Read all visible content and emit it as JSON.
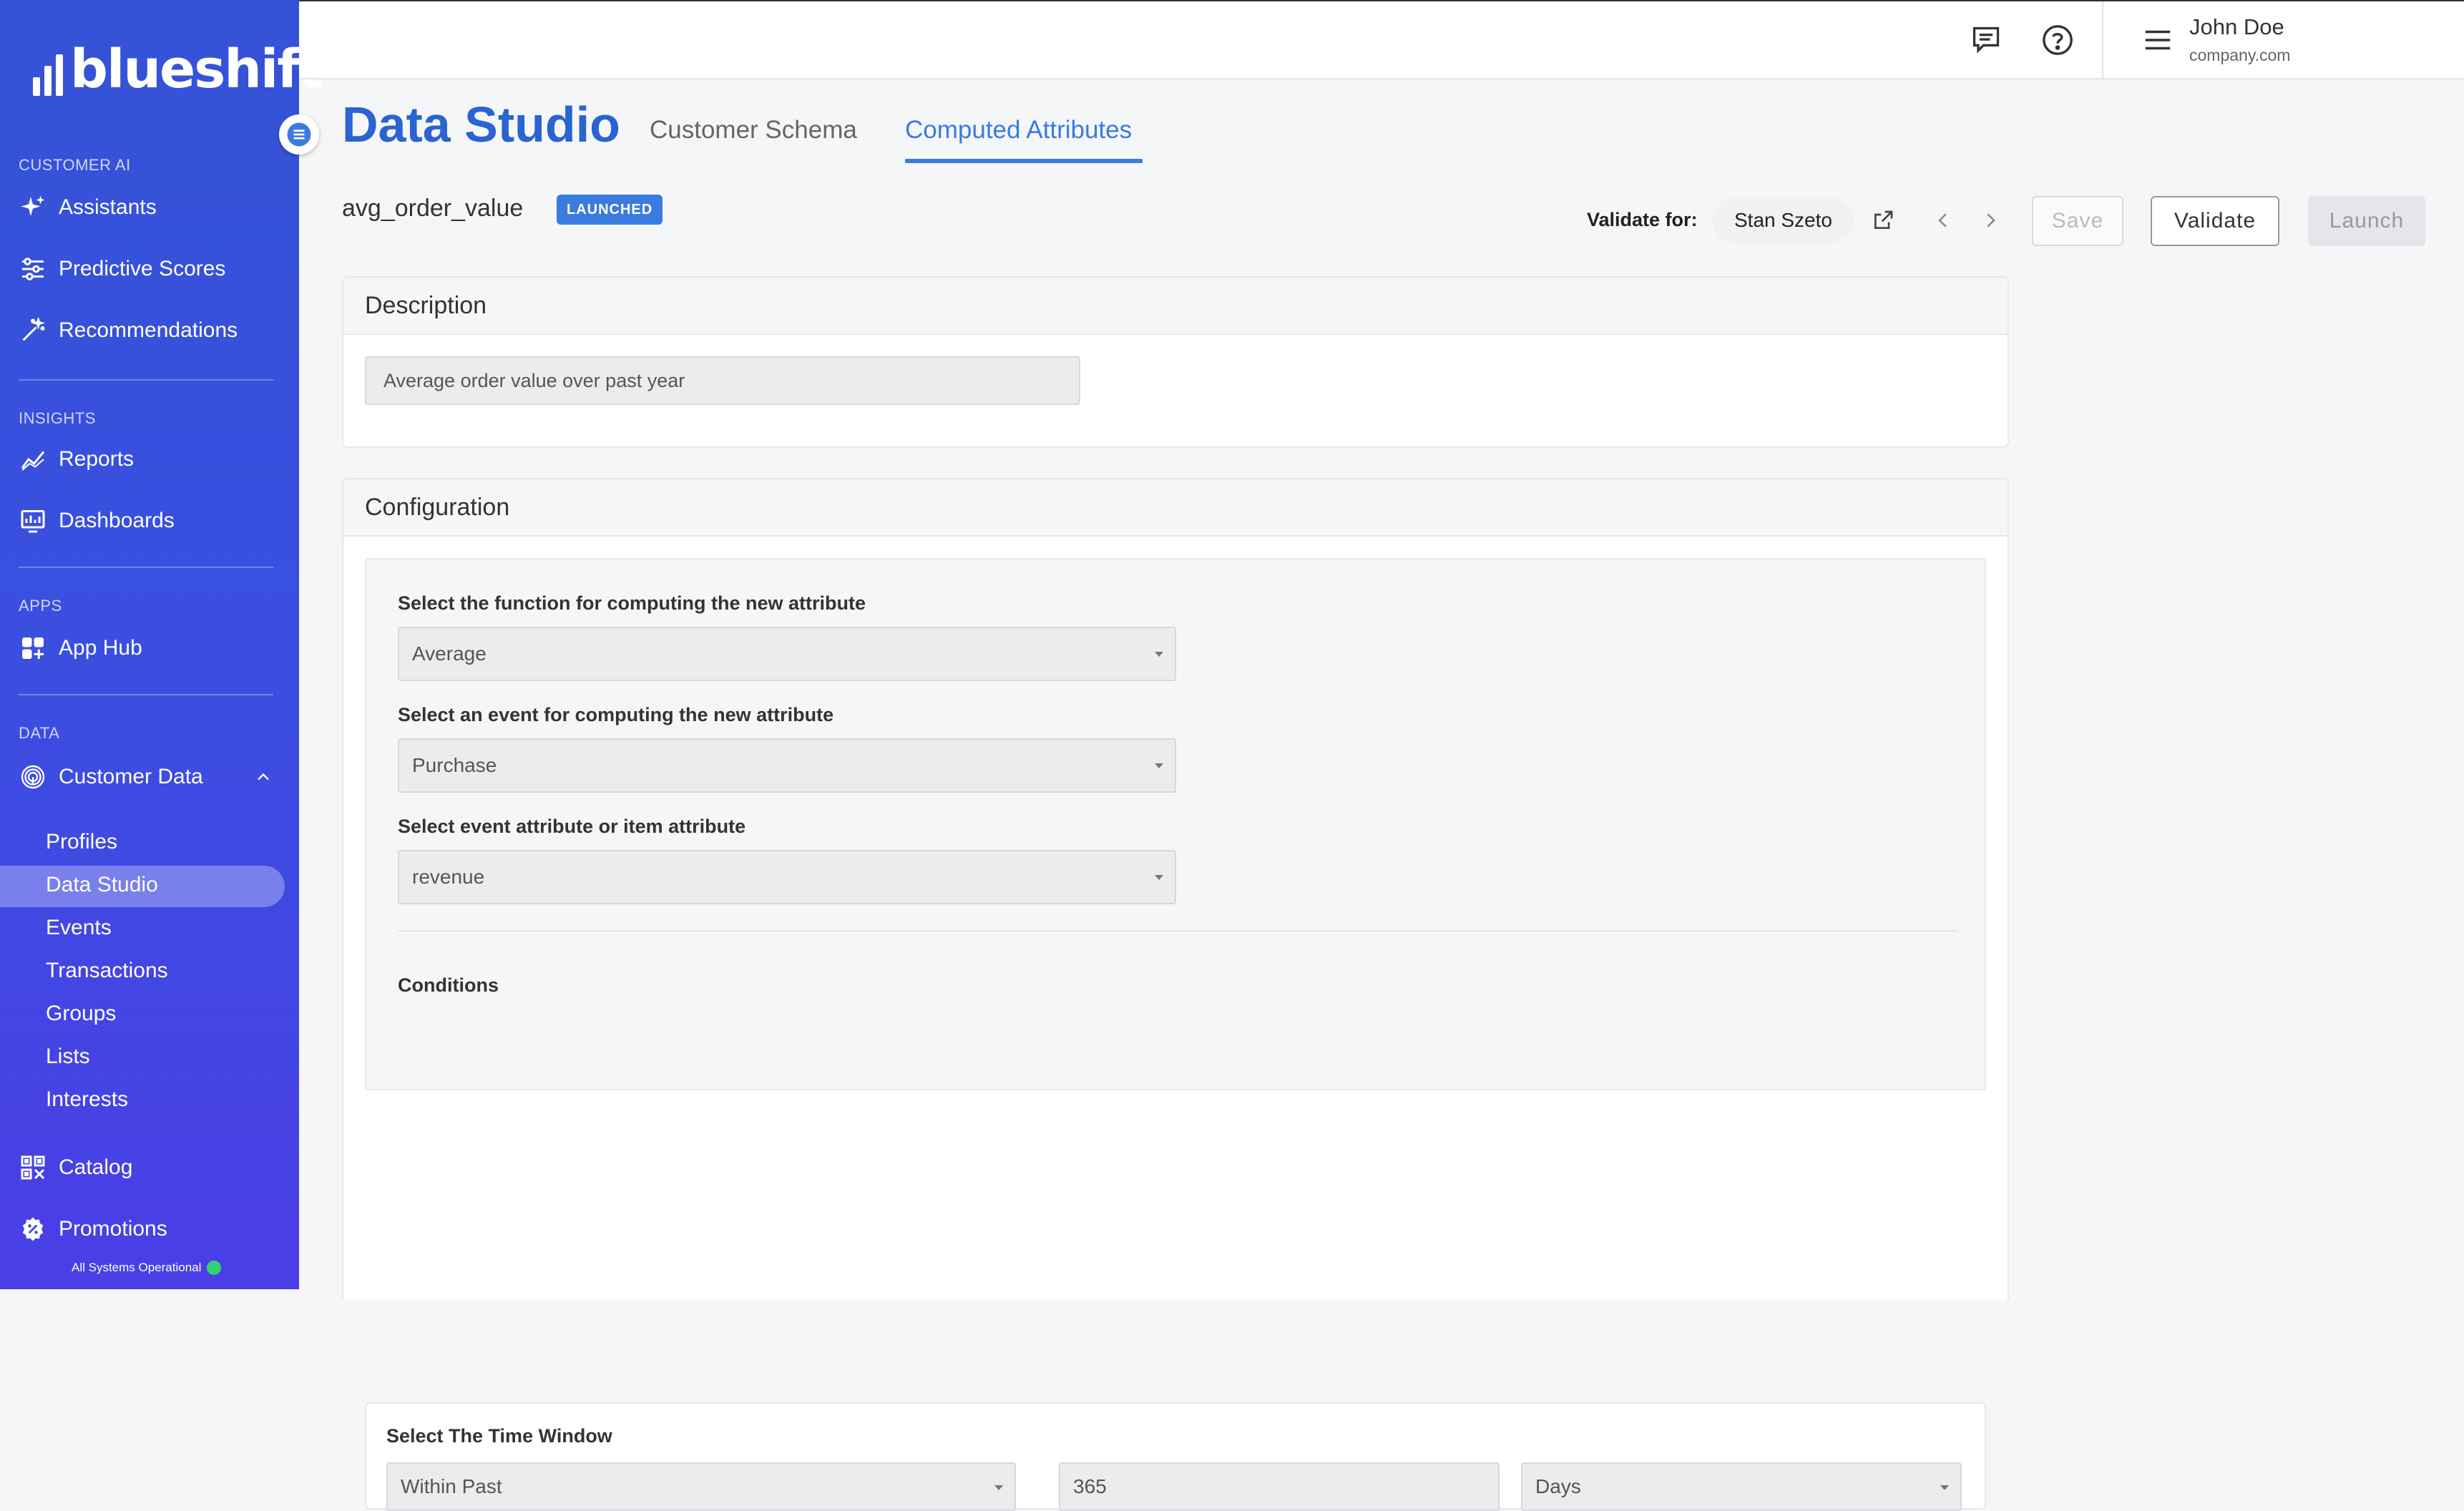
{
  "brand": {
    "logo_text": "blueshift"
  },
  "sidebar": {
    "sections": {
      "customer_ai": "CUSTOMER AI",
      "insights": "INSIGHTS",
      "apps": "APPS",
      "data": "DATA"
    },
    "items": {
      "assistants": "Assistants",
      "predictive_scores": "Predictive Scores",
      "recommendations": "Recommendations",
      "reports": "Reports",
      "dashboards": "Dashboards",
      "app_hub": "App Hub",
      "customer_data": "Customer Data",
      "catalog": "Catalog",
      "promotions": "Promotions"
    },
    "sub_items": [
      "Profiles",
      "Data Studio",
      "Events",
      "Transactions",
      "Groups",
      "Lists",
      "Interests"
    ],
    "active_sub_item": "Data Studio",
    "status_text": "All Systems Operational"
  },
  "topbar": {
    "user_name": "John Doe",
    "user_org": "company.com"
  },
  "page": {
    "title": "Data Studio",
    "tabs": [
      "Customer Schema",
      "Computed Attributes"
    ],
    "active_tab": "Computed Attributes"
  },
  "attribute": {
    "name": "avg_order_value",
    "status_badge": "LAUNCHED"
  },
  "toolbar": {
    "validate_label": "Validate for:",
    "validate_user": "Stan Szeto",
    "save_label": "Save",
    "validate_button": "Validate",
    "launch_label": "Launch"
  },
  "description": {
    "header": "Description",
    "value": "Average order value over past year"
  },
  "configuration": {
    "header": "Configuration",
    "function_label": "Select the function for computing the new attribute",
    "function_value": "Average",
    "event_label": "Select an event for computing the new attribute",
    "event_value": "Purchase",
    "attribute_label": "Select event attribute or item attribute",
    "attribute_value": "revenue",
    "conditions_label": "Conditions"
  },
  "time_window": {
    "label": "Select The Time Window",
    "range_value": "Within Past",
    "amount_value": "365",
    "unit_value": "Days"
  },
  "colors": {
    "brand_blue": "#3a7be0",
    "title_blue": "#2a63d2",
    "status_green": "#2fd470"
  }
}
